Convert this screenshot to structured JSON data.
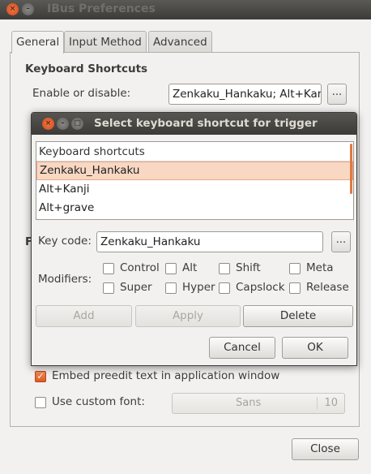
{
  "window": {
    "title": "IBus Preferences",
    "controls": {
      "close": "×",
      "minimize": "–",
      "maximize": "□"
    }
  },
  "tabs": [
    {
      "label": "General",
      "active": true
    },
    {
      "label": "Input Method",
      "active": false
    },
    {
      "label": "Advanced",
      "active": false
    }
  ],
  "general": {
    "keyboard_shortcuts_heading": "Keyboard Shortcuts",
    "enable_disable_label": "Enable or disable:",
    "enable_disable_value": "Zenkaku_Hankaku; Alt+Kanji",
    "browse_label": "...",
    "hidden_section_letter": "F",
    "embed_preedit_label": "Embed preedit text in application window",
    "embed_preedit_checked": true,
    "custom_font_label": "Use custom font:",
    "custom_font_checked": false,
    "font_name": "Sans",
    "font_size": "10",
    "close_label": "Close"
  },
  "dialog": {
    "title": "Select keyboard shortcut for trigger",
    "controls": {
      "close": "×",
      "minimize": "–",
      "maximize": "□"
    },
    "list_header": "Keyboard shortcuts",
    "list_items": [
      "Zenkaku_Hankaku",
      "Alt+Kanji",
      "Alt+grave"
    ],
    "selected_index": 0,
    "keycode_label": "Key code:",
    "keycode_value": "Zenkaku_Hankaku",
    "keycode_browse": "...",
    "modifiers_label": "Modifiers:",
    "modifiers": [
      "Control",
      "Alt",
      "Shift",
      "Meta",
      "Super",
      "Hyper",
      "Capslock",
      "Release"
    ],
    "add_label": "Add",
    "apply_label": "Apply",
    "delete_label": "Delete",
    "cancel_label": "Cancel",
    "ok_label": "OK"
  },
  "colors": {
    "accent": "#dd5a22",
    "selection": "#f8d7c3",
    "titlebar": "#3c3b37"
  }
}
